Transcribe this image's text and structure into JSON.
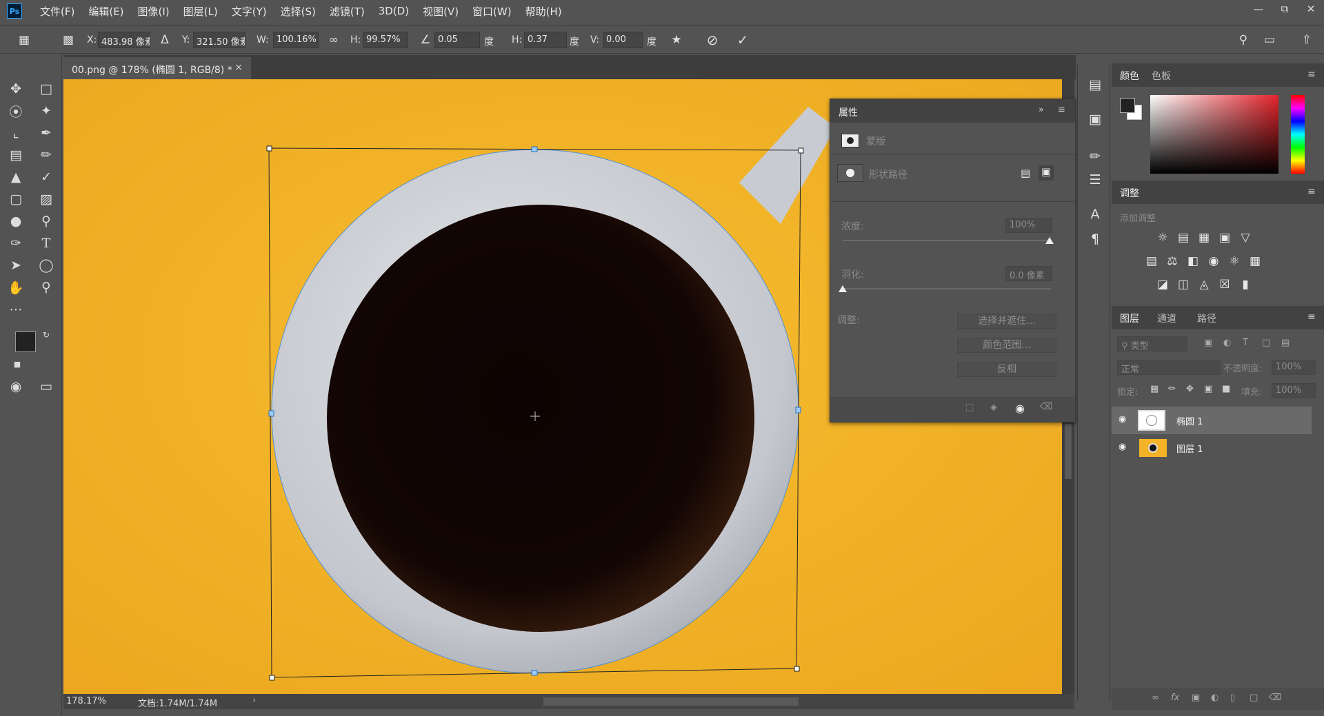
{
  "app": {
    "logo": "Ps"
  },
  "menu": [
    "文件(F)",
    "编辑(E)",
    "图像(I)",
    "图层(L)",
    "文字(Y)",
    "选择(S)",
    "滤镜(T)",
    "3D(D)",
    "视图(V)",
    "窗口(W)",
    "帮助(H)"
  ],
  "window_controls": [
    "minimize-icon",
    "restore-icon",
    "close-icon"
  ],
  "options": {
    "x_label": "X:",
    "x_value": "483.98 像素",
    "y_label": "Y:",
    "y_value": "321.50 像素",
    "w_label": "W:",
    "w_value": "100.16%",
    "h_label": "H:",
    "h_value": "99.57%",
    "angle_value": "0.05",
    "angle_unit": "度",
    "hskew_label": "H:",
    "hskew_value": "0.37",
    "hskew_unit": "度",
    "vskew_label": "V:",
    "vskew_value": "0.00",
    "vskew_unit": "度"
  },
  "document": {
    "tab_title": "00.png @ 178% (椭圆 1, RGB/8) *",
    "zoom": "178.17%",
    "doc_size": "文档:1.74M/1.74M",
    "canvas_color": "#f4b327"
  },
  "properties": {
    "title": "属性",
    "mask_label": "蒙版",
    "shape_path_label": "形状路径",
    "density_label": "浓度:",
    "density_value": "100%",
    "feather_label": "羽化:",
    "feather_value": "0.0 像素",
    "adjust_label": "调整:",
    "buttons": [
      "选择并遮住...",
      "颜色范围...",
      "反相"
    ]
  },
  "color_panel": {
    "tabs": [
      "颜色",
      "色板"
    ]
  },
  "adjust_panel": {
    "title": "调整",
    "add_label": "添加调整"
  },
  "layers_panel": {
    "tabs": [
      "图层",
      "通道",
      "路径"
    ],
    "filter_placeholder": "类型",
    "blend_mode": "正常",
    "opacity_label": "不透明度:",
    "opacity_value": "100%",
    "lock_label": "锁定:",
    "fill_label": "填充:",
    "fill_value": "100%",
    "layers": [
      {
        "name": "椭圆 1",
        "selected": true
      },
      {
        "name": "图层 1",
        "selected": false
      }
    ]
  },
  "colors": {
    "foreground": "#222222",
    "background": "#ffffff",
    "accent": "#31a8ff"
  }
}
